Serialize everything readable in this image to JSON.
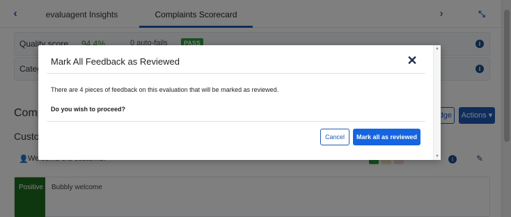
{
  "tabs": {
    "items": [
      {
        "label": "evaluagent Insights"
      },
      {
        "label": "Complaints Scorecard"
      }
    ]
  },
  "quality": {
    "label": "Quality score",
    "score": "94.4%",
    "auto_fails": "0 auto-fails",
    "status": "PASS"
  },
  "category": {
    "label": "Catego"
  },
  "section": {
    "heading": "Comp",
    "badge_button": "dge",
    "actions_button": "Actions ▾"
  },
  "subsection": {
    "heading": "Custo"
  },
  "feedback": {
    "text": "Welcome the customer",
    "comment": {
      "sentiment": "Positive",
      "text": "Bubbly welcome"
    }
  },
  "modal": {
    "title": "Mark All Feedback as Reviewed",
    "message": "There are 4 pieces of feedback on this evaluation that will be marked as reviewed.",
    "question": "Do you wish to proceed?",
    "cancel_label": "Cancel",
    "confirm_label": "Mark all as reviewed"
  },
  "colors": {
    "primary": "#1565e0",
    "pass": "#2e9e3e",
    "positive": "#1f6e1f"
  }
}
